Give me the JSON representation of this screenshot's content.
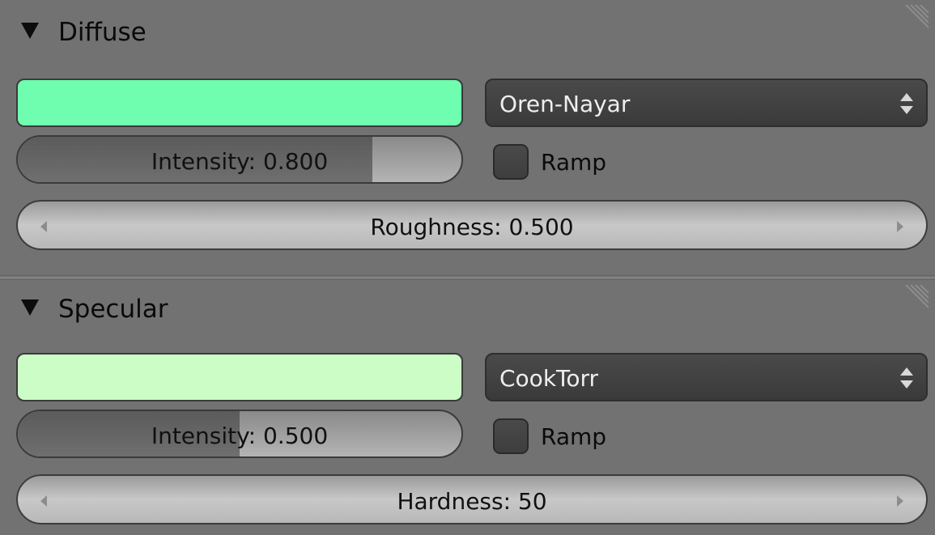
{
  "diffuse": {
    "title": "Diffuse",
    "color": "#6ffdb0",
    "shader": "Oren-Nayar",
    "intensity_text": "Intensity: 0.800",
    "intensity_fraction": 0.8,
    "ramp_label": "Ramp",
    "ramp_checked": false,
    "roughness_text": "Roughness: 0.500"
  },
  "specular": {
    "title": "Specular",
    "color": "#ccfdc6",
    "shader": "CookTorr",
    "intensity_text": "Intensity: 0.500",
    "intensity_fraction": 0.5,
    "ramp_label": "Ramp",
    "ramp_checked": false,
    "hardness_text": "Hardness: 50"
  },
  "icons": {
    "collapse": "triangle-down-icon",
    "dropdown": "up-down-arrows-icon",
    "grip": "panel-grip-icon",
    "decrement": "arrow-left-icon",
    "increment": "arrow-right-icon"
  }
}
